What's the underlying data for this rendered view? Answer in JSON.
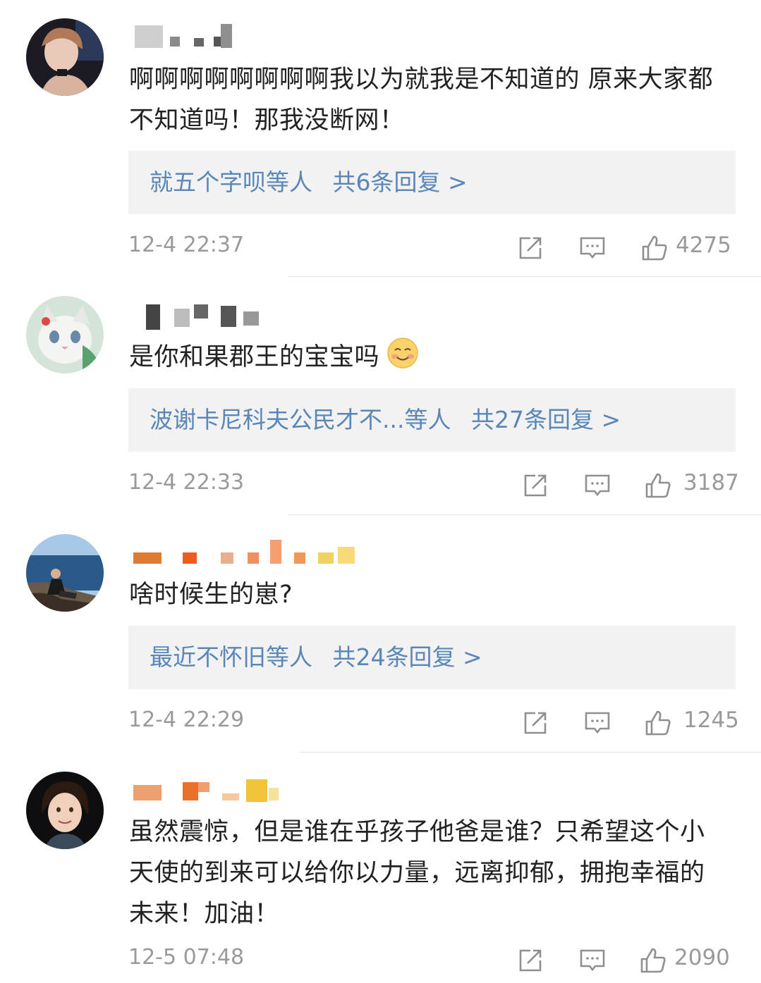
{
  "comments": [
    {
      "text": "啊啊啊啊啊啊啊啊我以为就我是不知道的 原来大家都不知道吗！那我没断网！",
      "reply_prefix": "就五个字呗等人",
      "reply_count_label": "共6条回复 >",
      "time": "12-4 22:37",
      "likes": "4275"
    },
    {
      "text": "是你和果郡王的宝宝吗",
      "reply_prefix": "波谢卡尼科夫公民才不...等人",
      "reply_count_label": "共27条回复 >",
      "time": "12-4 22:33",
      "likes": "3187"
    },
    {
      "text": "啥时候生的崽?",
      "reply_prefix": "最近不怀旧等人",
      "reply_count_label": "共24条回复 >",
      "time": "12-4 22:29",
      "likes": "1245"
    },
    {
      "text": "虽然震惊，但是谁在乎孩子他爸是谁？只希望这个小天使的到来可以给你以力量，远离抑郁，拥抱幸福的未来！加油！",
      "time": "12-5 07:48",
      "likes": "2090"
    }
  ],
  "icons": {
    "share": "share-icon",
    "comment": "comment-icon",
    "like": "thumbs-up-icon",
    "emoji": "smiling-face-emoji"
  },
  "colors": {
    "link": "#5a86b8",
    "text": "#222222",
    "meta": "#9a9a9a",
    "reply_bg": "#f2f2f2"
  }
}
